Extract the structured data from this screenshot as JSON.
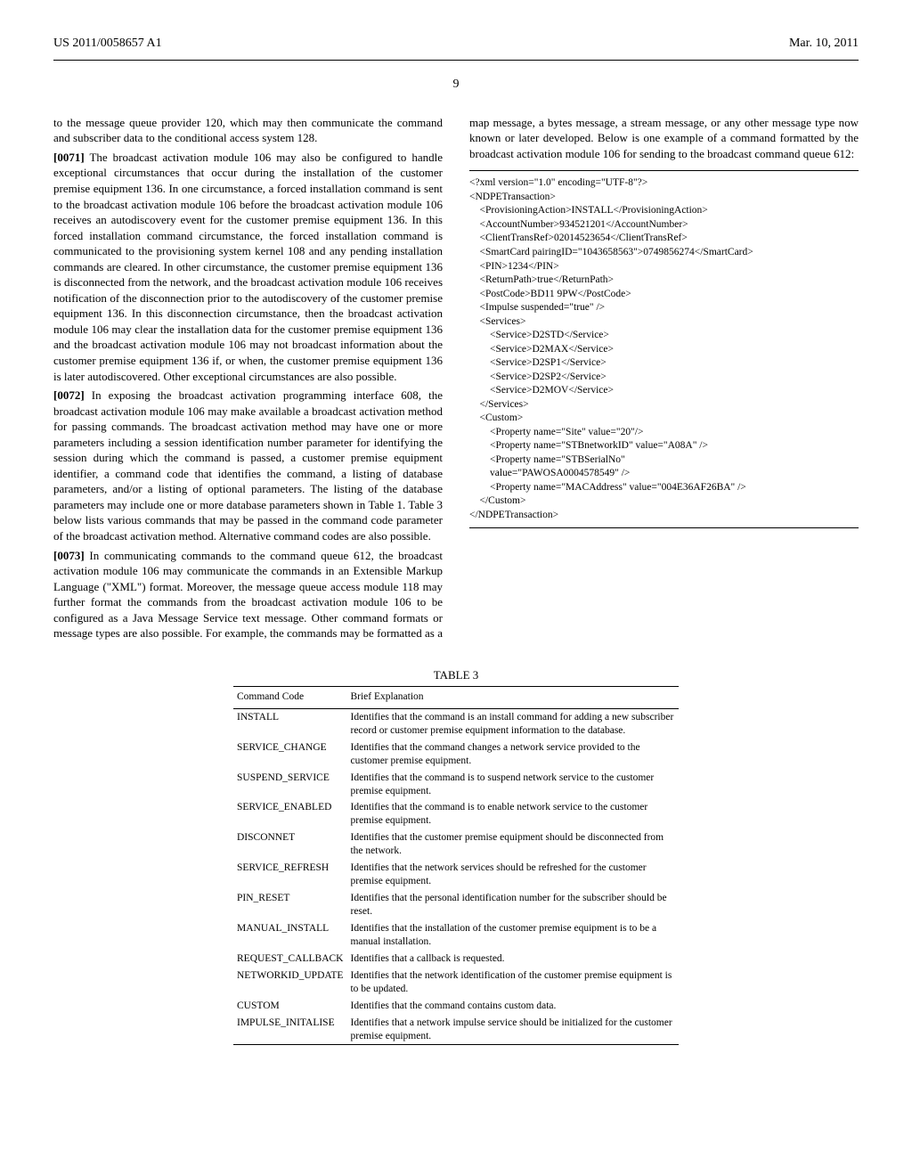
{
  "header": {
    "left": "US 2011/0058657 A1",
    "right": "Mar. 10, 2011"
  },
  "page_number": "9",
  "col_left": {
    "p0": "to the message queue provider 120, which may then communicate the command and subscriber data to the conditional access system 128.",
    "p1_num": "[0071]",
    "p1": "    The broadcast activation module 106 may also be configured to handle exceptional circumstances that occur during the installation of the customer premise equipment 136. In one circumstance, a forced installation command is sent to the broadcast activation module 106 before the broadcast activation module 106 receives an autodiscovery event for the customer premise equipment 136. In this forced installation command circumstance, the forced installation command is communicated to the provisioning system kernel 108 and any pending installation commands are cleared. In other circumstance, the customer premise equipment 136 is disconnected from the network, and the broadcast activation module 106 receives notification of the disconnection prior to the autodiscovery of the customer premise equipment 136. In this disconnection circumstance, then the broadcast activation module 106 may clear the installation data for the customer premise equipment 136 and the broadcast activation module 106 may not broadcast information about the customer premise equipment 136 if, or when, the customer premise equipment 136 is later autodiscovered. Other exceptional circumstances are also possible.",
    "p2_num": "[0072]",
    "p2": "    In exposing the broadcast activation programming interface 608, the broadcast activation module 106 may make available a broadcast activation method for passing commands. The broadcast activation method may have one or more parameters including a session identification number parameter for identifying the session during which the command is passed, a customer premise equipment identifier, a command code that identifies the command, a listing of database parameters, and/or a listing of optional parameters. The listing of the database parameters may include one or more database parameters shown in Table 1. Table 3 below lists various commands that may be passed in the command code parameter of the broadcast activation method. Alternative command codes are also possible."
  },
  "col_right": {
    "p3_num": "[0073]",
    "p3": "    In communicating commands to the command queue 612, the broadcast activation module 106 may communicate the commands in an Extensible Markup Language (\"XML\") format. Moreover, the message queue access module 118 may further format the commands from the broadcast activation module 106 to be configured as a Java Message Service text message. Other command formats or message types are also possible. For example, the commands may be formatted as a map message, a bytes message, a stream message, or any other message type now known or later developed. Below is one example of a command formatted by the broadcast activation module 106 for sending to the broadcast command queue 612:"
  },
  "xml_block": "<?xml version=\"1.0\" encoding=\"UTF-8\"?>\n<NDPETransaction>\n    <ProvisioningAction>INSTALL</ProvisioningAction>\n    <AccountNumber>934521201</AccountNumber>\n    <ClientTransRef>02014523654</ClientTransRef>\n    <SmartCard pairingID=\"1043658563\">0749856274</SmartCard>\n    <PIN>1234</PIN>\n    <ReturnPath>true</ReturnPath>\n    <PostCode>BD11 9PW</PostCode>\n    <Impulse suspended=\"true\" />\n    <Services>\n        <Service>D2STD</Service>\n        <Service>D2MAX</Service>\n        <Service>D2SP1</Service>\n        <Service>D2SP2</Service>\n        <Service>D2MOV</Service>\n    </Services>\n    <Custom>\n        <Property name=\"Site\" value=\"20\"/>\n        <Property name=\"STBnetworkID\" value=\"A08A\" />\n        <Property name=\"STBSerialNo\"\n        value=\"PAWOSA0004578549\" />\n        <Property name=\"MACAddress\" value=\"004E36AF26BA\" />\n    </Custom>\n</NDPETransaction>",
  "table": {
    "title": "TABLE 3",
    "headers": [
      "Command Code",
      "Brief Explanation"
    ],
    "rows": [
      [
        "INSTALL",
        "Identifies that the command is an install command for adding a new subscriber record or customer premise equipment information to the database."
      ],
      [
        "SERVICE_CHANGE",
        "Identifies that the command changes a network service provided to the customer premise equipment."
      ],
      [
        "SUSPEND_SERVICE",
        "Identifies that the command is to suspend network service to the customer premise equipment."
      ],
      [
        "SERVICE_ENABLED",
        "Identifies that the command is to enable network service to the customer premise equipment."
      ],
      [
        "DISCONNET",
        "Identifies that the customer premise equipment should be disconnected from the network."
      ],
      [
        "SERVICE_REFRESH",
        "Identifies that the network services should be refreshed for the customer premise equipment."
      ],
      [
        "PIN_RESET",
        "Identifies that the personal identification number for the subscriber should be reset."
      ],
      [
        "MANUAL_INSTALL",
        "Identifies that the installation of the customer premise equipment is to be a manual installation."
      ],
      [
        "REQUEST_CALLBACK",
        "Identifies that a callback is requested."
      ],
      [
        "NETWORKID_UPDATE",
        "Identifies that the network identification of the customer premise equipment is to be updated."
      ],
      [
        "CUSTOM",
        "Identifies that the command contains custom data."
      ],
      [
        "IMPULSE_INITALISE",
        "Identifies that a network impulse service should be initialized for the customer premise equipment."
      ]
    ]
  }
}
